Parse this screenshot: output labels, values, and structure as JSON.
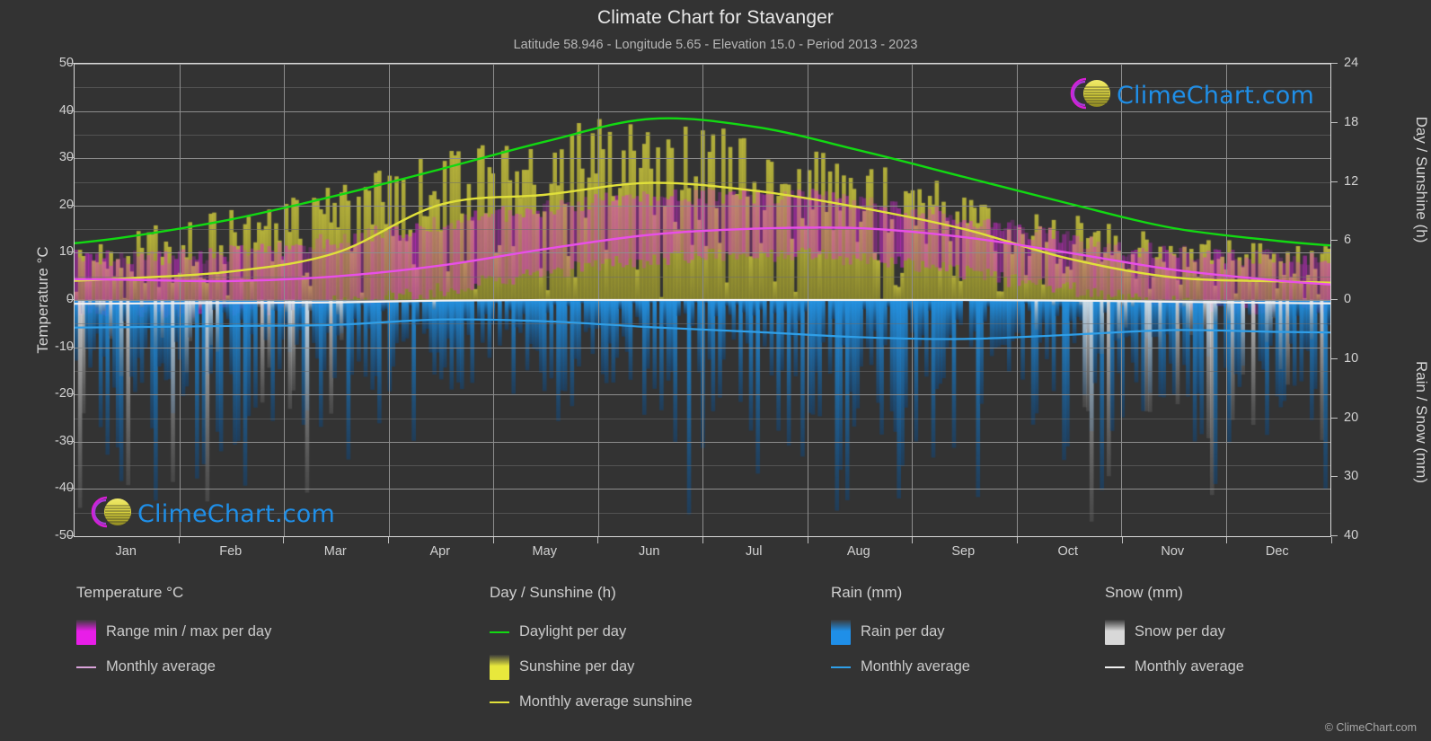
{
  "header": {
    "title": "Climate Chart for Stavanger",
    "subtitle": "Latitude 58.946 - Longitude 5.65 - Elevation 15.0 - Period 2013 - 2023"
  },
  "branding": {
    "watermark_text": "ClimeChart.com",
    "copyright": "© ClimeChart.com",
    "logo_arc_color": "#d61fd6",
    "logo_sphere_color": "#d8d13a",
    "logo_text_color": "#1f8fe8"
  },
  "axes": {
    "left_title": "Temperature °C",
    "right_top_title": "Day / Sunshine (h)",
    "right_bottom_title": "Rain / Snow (mm)",
    "left_ticks": [
      "50",
      "40",
      "30",
      "20",
      "10",
      "0",
      "-10",
      "-20",
      "-30",
      "-40",
      "-50"
    ],
    "right_top_ticks": [
      "24",
      "18",
      "12",
      "6",
      "0"
    ],
    "right_bottom_ticks": [
      "10",
      "20",
      "30",
      "40"
    ],
    "x_ticks": [
      "Jan",
      "Feb",
      "Mar",
      "Apr",
      "May",
      "Jun",
      "Jul",
      "Aug",
      "Sep",
      "Oct",
      "Nov",
      "Dec"
    ]
  },
  "legend": {
    "groups": [
      {
        "title": "Temperature °C",
        "items": [
          {
            "label": "Range min / max per day",
            "marker": "swatch",
            "color": "#e81ee8"
          },
          {
            "label": "Monthly average",
            "marker": "line",
            "color": "#d9a3d9"
          }
        ]
      },
      {
        "title": "Day / Sunshine (h)",
        "items": [
          {
            "label": "Daylight per day",
            "marker": "line",
            "color": "#12d912"
          },
          {
            "label": "Sunshine per day",
            "marker": "swatch",
            "color": "#e8e83c"
          },
          {
            "label": "Monthly average sunshine",
            "marker": "line",
            "color": "#e0e03a"
          }
        ]
      },
      {
        "title": "Rain (mm)",
        "items": [
          {
            "label": "Rain per day",
            "marker": "swatch",
            "color": "#1f8fe8"
          },
          {
            "label": "Monthly average",
            "marker": "line",
            "color": "#2f9fe8"
          }
        ]
      },
      {
        "title": "Snow (mm)",
        "items": [
          {
            "label": "Snow per day",
            "marker": "swatch",
            "color": "#d8d8d8"
          },
          {
            "label": "Monthly average",
            "marker": "line",
            "color": "#f0f0f0"
          }
        ]
      }
    ]
  },
  "chart_data": {
    "type": "line",
    "title": "Climate Chart for Stavanger",
    "subtitle": "Latitude 58.946 - Longitude 5.65 - Elevation 15.0 - Period 2013 - 2023",
    "xlabel": "",
    "ylabel": "Temperature °C",
    "x": [
      "Jan",
      "Feb",
      "Mar",
      "Apr",
      "May",
      "Jun",
      "Jul",
      "Aug",
      "Sep",
      "Oct",
      "Nov",
      "Dec"
    ],
    "ylim_left": [
      -50,
      50
    ],
    "ylim_right_top": [
      0,
      24
    ],
    "ylim_right_bottom": [
      0,
      40
    ],
    "grid": true,
    "legend_position": "below",
    "series": [
      {
        "name": "Daylight per day",
        "unit": "h",
        "axis": "right_top",
        "color": "#12d912",
        "values": [
          6.4,
          8.2,
          10.6,
          13.3,
          16.1,
          18.4,
          17.6,
          15.2,
          12.5,
          9.8,
          7.3,
          6.0
        ]
      },
      {
        "name": "Monthly average sunshine",
        "unit": "h",
        "axis": "right_top",
        "color": "#e0e03a",
        "values": [
          2.2,
          2.9,
          4.8,
          9.7,
          10.7,
          11.9,
          11.1,
          9.4,
          7.2,
          4.2,
          2.3,
          1.9
        ]
      },
      {
        "name": "Monthly average temperature",
        "unit": "°C",
        "axis": "left",
        "color": "#e84fe8",
        "values": [
          4.3,
          4.0,
          5.0,
          7.3,
          10.8,
          13.8,
          15.1,
          15.2,
          13.3,
          10.0,
          6.4,
          4.1
        ]
      },
      {
        "name": "Monthly average rain",
        "unit": "mm",
        "axis": "right_bottom",
        "color": "#2f9fe8",
        "values": [
          4.6,
          4.4,
          4.2,
          3.3,
          3.6,
          4.6,
          5.4,
          6.3,
          6.6,
          5.9,
          5.1,
          5.4
        ]
      },
      {
        "name": "Monthly average snow",
        "unit": "mm",
        "axis": "right_bottom",
        "color": "#f0f0f0",
        "values": [
          0.6,
          0.5,
          0.4,
          0.1,
          0.0,
          0.0,
          0.0,
          0.0,
          0.0,
          0.1,
          0.3,
          0.5
        ]
      }
    ],
    "bands": [
      {
        "name": "Range min / max per day",
        "unit": "°C",
        "axis": "left",
        "color": "#e81ee8",
        "min": [
          -2.0,
          -2.5,
          -1.5,
          0.5,
          4.0,
          7.5,
          9.5,
          9.5,
          7.5,
          4.0,
          0.5,
          -1.5
        ],
        "max": [
          9.0,
          9.0,
          11.0,
          14.5,
          18.0,
          21.0,
          22.0,
          22.0,
          19.0,
          15.0,
          11.0,
          9.0
        ]
      },
      {
        "name": "Sunshine per day",
        "unit": "h",
        "axis": "right_top",
        "color": "#e8e83c",
        "min": [
          0,
          0,
          0,
          0,
          0,
          0,
          0,
          0,
          0,
          0,
          0,
          0
        ],
        "max": [
          6.4,
          8.2,
          10.6,
          13.3,
          16.1,
          18.4,
          17.6,
          15.2,
          12.5,
          9.8,
          7.3,
          6.0
        ]
      },
      {
        "name": "Rain per day",
        "unit": "mm",
        "axis": "right_bottom",
        "color": "#1f8fe8",
        "min": [
          0,
          0,
          0,
          0,
          0,
          0,
          0,
          0,
          0,
          0,
          0,
          0
        ],
        "max": [
          38,
          35,
          33,
          30,
          28,
          30,
          34,
          37,
          39,
          38,
          36,
          37
        ]
      }
    ]
  }
}
